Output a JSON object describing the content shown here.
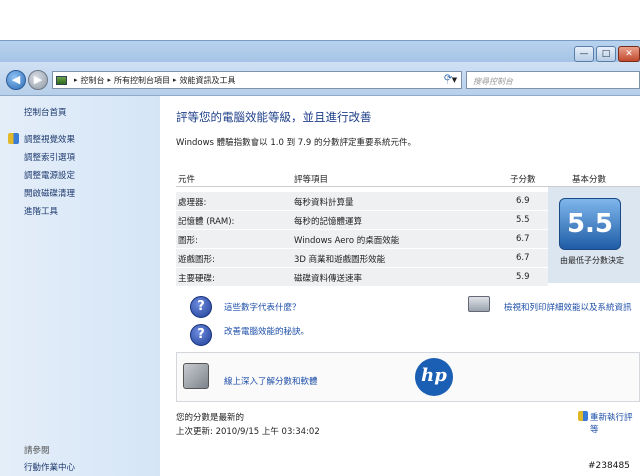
{
  "window": {
    "min_glyph": "—",
    "max_glyph": "□",
    "close_glyph": "✕"
  },
  "nav": {
    "back_glyph": "◀",
    "forward_glyph": "▶",
    "breadcrumb": [
      "控制台",
      "所有控制台項目",
      "效能資訊及工具"
    ],
    "crumb_sep": "▸",
    "search_placeholder": "搜尋控制台"
  },
  "left_pane": {
    "home": "控制台首頁",
    "items": [
      "調整視覺效果",
      "調整索引選項",
      "調整電源設定",
      "開啟磁碟清理",
      "進階工具"
    ],
    "see_also": "請參閱",
    "action_center": "行動作業中心"
  },
  "main": {
    "title": "評等您的電腦效能等級，並且進行改善",
    "subtitle": "Windows 體驗指數會以 1.0 到 7.9 的分數評定重要系統元件。",
    "columns": [
      "元件",
      "評等項目",
      "子分數",
      "基本分數"
    ],
    "rows": [
      {
        "component": "處理器:",
        "item": "每秒資料計算量",
        "score": "6.9"
      },
      {
        "component": "記憶體 (RAM):",
        "item": "每秒的記憶體運算",
        "score": "5.5"
      },
      {
        "component": "圖形:",
        "item": "Windows Aero 的桌面效能",
        "score": "6.7"
      },
      {
        "component": "遊戲圖形:",
        "item": "3D 商業和遊戲圖形效能",
        "score": "6.7"
      },
      {
        "component": "主要硬碟:",
        "item": "磁碟資料傳送速率",
        "score": "5.9"
      }
    ],
    "base_score": "5.5",
    "base_caption": "由最低子分數決定",
    "links": {
      "what_numbers": "這些數字代表什麼？",
      "improve_tips": "改善電腦效能的秘訣。",
      "view_print": "檢視和列印詳細效能以及系統資訊",
      "learn_more": "線上深入了解分數和軟體"
    },
    "hp_logo": "hp",
    "status_current": "您的分數是最新的",
    "last_update": "上次更新: 2010/9/15 上午 03:34:02",
    "rerun": "重新執行評等"
  },
  "watermark": "#238485"
}
